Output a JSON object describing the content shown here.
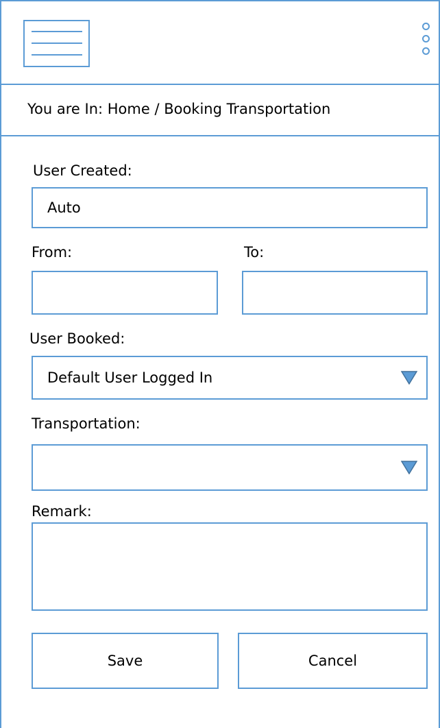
{
  "header": {
    "menu_icon": "hamburger-menu-icon",
    "more_icon": "vertical-dots-icon"
  },
  "breadcrumb": {
    "text": "You are In: Home / Booking Transportation"
  },
  "form": {
    "user_created": {
      "label": "User Created:",
      "value": "Auto"
    },
    "from": {
      "label": "From:",
      "value": ""
    },
    "to": {
      "label": "To:",
      "value": ""
    },
    "user_booked": {
      "label": "User Booked:",
      "value": "Default User Logged In",
      "icon": "dropdown-arrow-icon"
    },
    "transportation": {
      "label": "Transportation:",
      "value": "",
      "icon": "dropdown-arrow-icon"
    },
    "remark": {
      "label": "Remark:",
      "value": ""
    }
  },
  "buttons": {
    "save": "Save",
    "cancel": "Cancel"
  },
  "colors": {
    "accent": "#5b9bd5",
    "background": "#ffffff",
    "text": "#000000"
  }
}
